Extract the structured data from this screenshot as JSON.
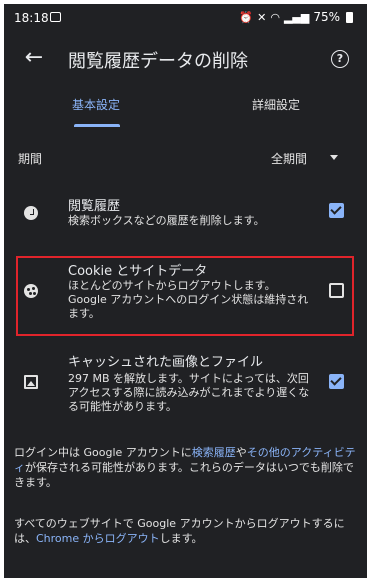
{
  "status_bar": {
    "time": "18:18",
    "battery": "75%"
  },
  "app_bar": {
    "title": "閲覧履歴データの削除",
    "back_glyph": "←",
    "help_glyph": "?"
  },
  "tabs": [
    {
      "label": "基本設定",
      "selected": true
    },
    {
      "label": "詳細設定",
      "selected": false
    }
  ],
  "period": {
    "label": "期間",
    "value": "全期間"
  },
  "items": [
    {
      "title": "閲覧履歴",
      "description": "検索ボックスなどの履歴を削除します。",
      "checked": true,
      "icon": "clock-icon"
    },
    {
      "title": "Cookie とサイトデータ",
      "description": "ほとんどのサイトからログアウトします。Google アカウントへのログイン状態は維持されます。",
      "checked": false,
      "icon": "cookie-icon"
    },
    {
      "title": "キャッシュされた画像とファイル",
      "description": "297 MB を解放します。サイトによっては、次回アクセスする際に読み込みがこれまでより遅くなる可能性があります。",
      "checked": true,
      "icon": "image-icon"
    }
  ],
  "footer1": {
    "part1": "ログイン中は Google アカウントに",
    "link1": "検索履歴",
    "part2": "や",
    "link2": "その他のアクティビティ",
    "part3": "が保存される可能性があります。これらのデータはいつでも削除できます。"
  },
  "footer2": {
    "part1": "すべてのウェブサイトで Google アカウントからログアウトするには、",
    "link": "Chrome からログアウト",
    "part2": "します。"
  },
  "colors": {
    "background": "#202124",
    "accent": "#8ab4f8",
    "highlight": "#e0242b"
  }
}
